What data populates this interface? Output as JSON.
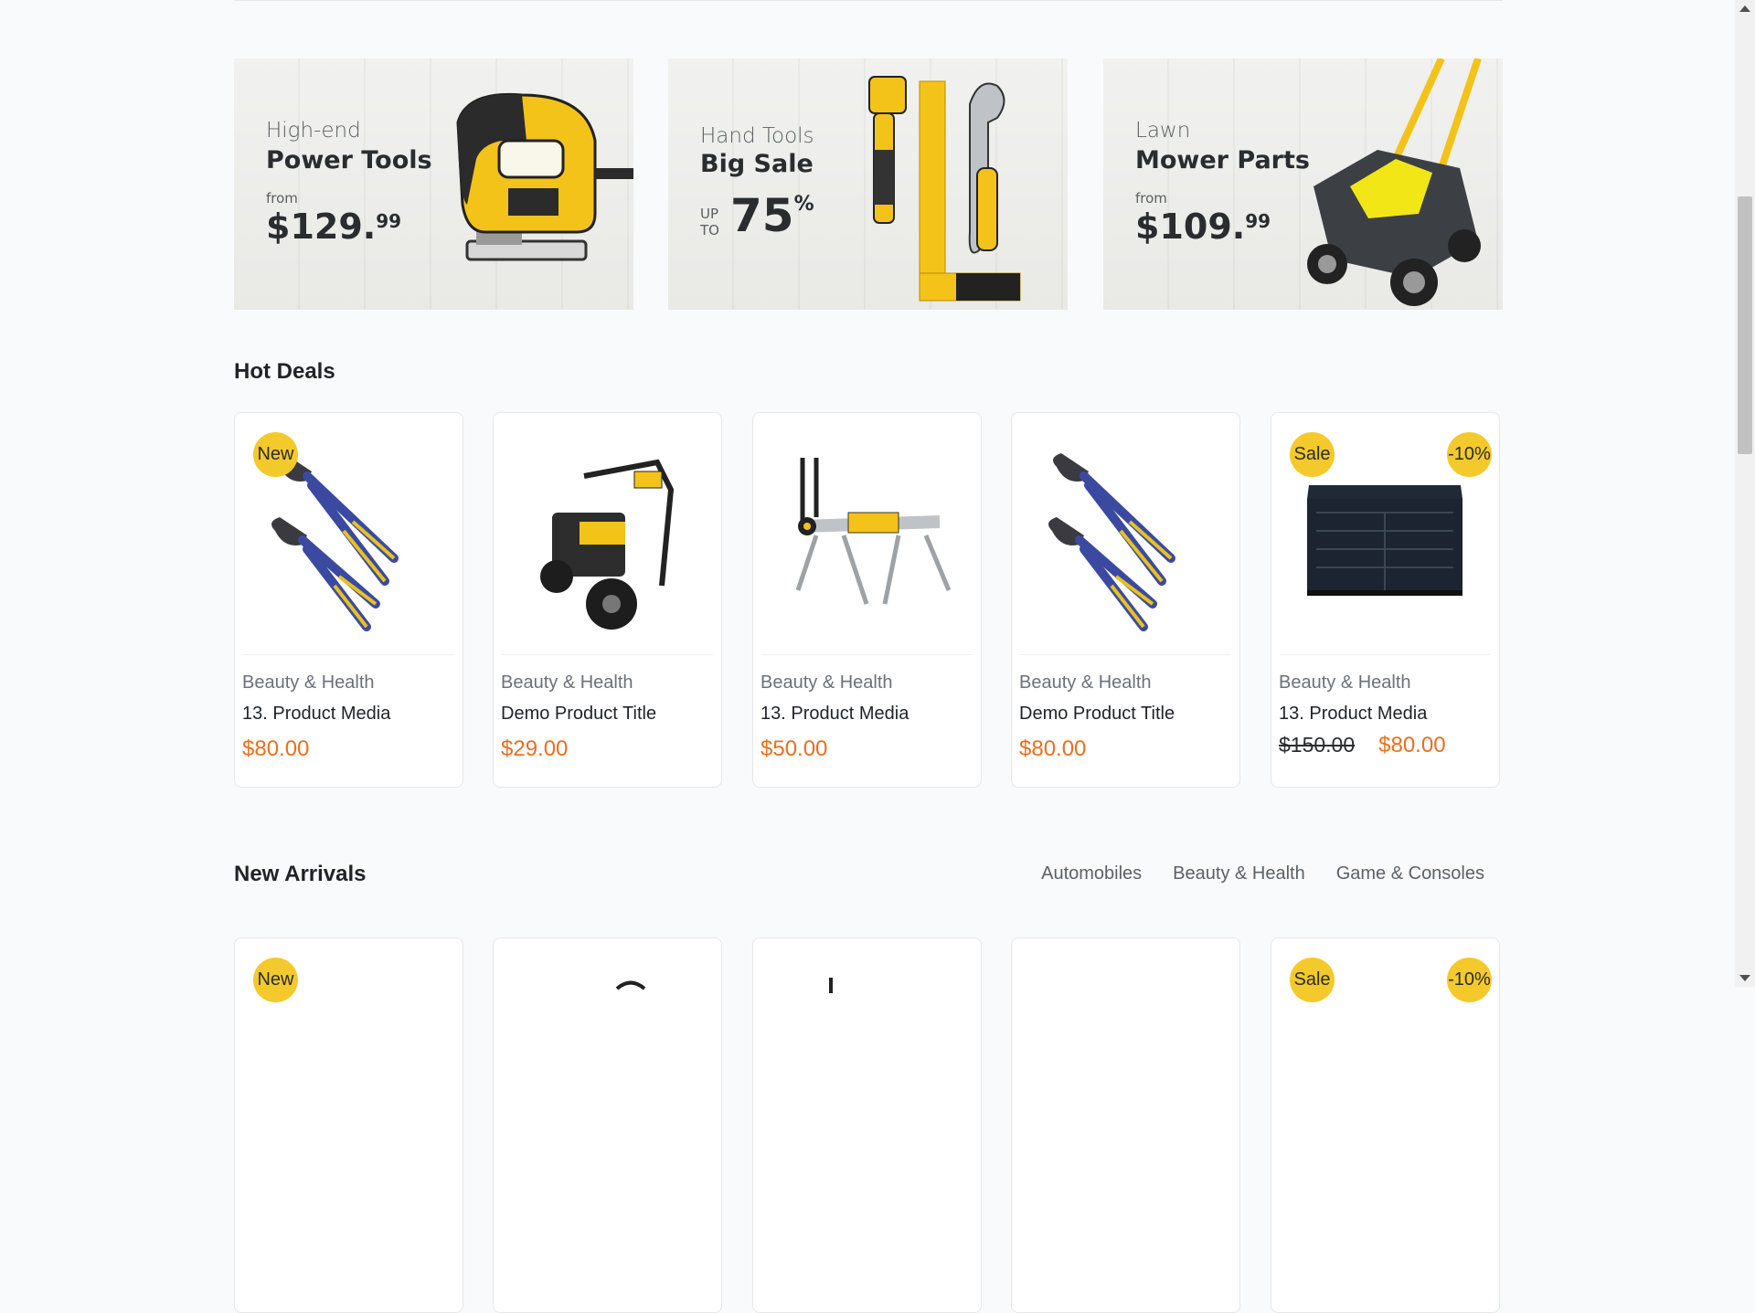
{
  "banners": [
    {
      "subtitle": "High-end",
      "title": "Power Tools",
      "from": "from",
      "price_main": "$129.",
      "price_cents": "99"
    },
    {
      "subtitle": "Hand Tools",
      "title": "Big Sale",
      "up": "UP",
      "to": "TO",
      "discount": "75",
      "pct": "%"
    },
    {
      "subtitle": "Lawn",
      "title": "Mower Parts",
      "from": "from",
      "price_main": "$109.",
      "price_cents": "99"
    }
  ],
  "hot_deals": {
    "title": "Hot Deals",
    "products": [
      {
        "badge_left": "New",
        "category": "Beauty & Health",
        "title": "13. Product Media",
        "price": "$80.00",
        "icon": "pliers-icon"
      },
      {
        "category": "Beauty & Health",
        "title": "Demo Product Title",
        "price": "$29.00",
        "icon": "pressure-washer-icon"
      },
      {
        "category": "Beauty & Health",
        "title": "13. Product Media",
        "price": "$50.00",
        "icon": "saw-stand-icon"
      },
      {
        "category": "Beauty & Health",
        "title": "Demo Product Title",
        "price": "$80.00",
        "icon": "pliers-icon"
      },
      {
        "badge_left": "Sale",
        "badge_right": "-10%",
        "category": "Beauty & Health",
        "title": "13. Product Media",
        "old_price": "$150.00",
        "price": "$80.00",
        "icon": "tool-chest-icon"
      }
    ]
  },
  "new_arrivals": {
    "title": "New Arrivals",
    "tabs": [
      "Automobiles",
      "Beauty & Health",
      "Game & Consoles"
    ],
    "badges": {
      "first": "New",
      "last_left": "Sale",
      "last_right": "-10%"
    }
  },
  "colors": {
    "accent": "#f4c92b",
    "price": "#ea6f1f",
    "background": "#f9fafb"
  }
}
